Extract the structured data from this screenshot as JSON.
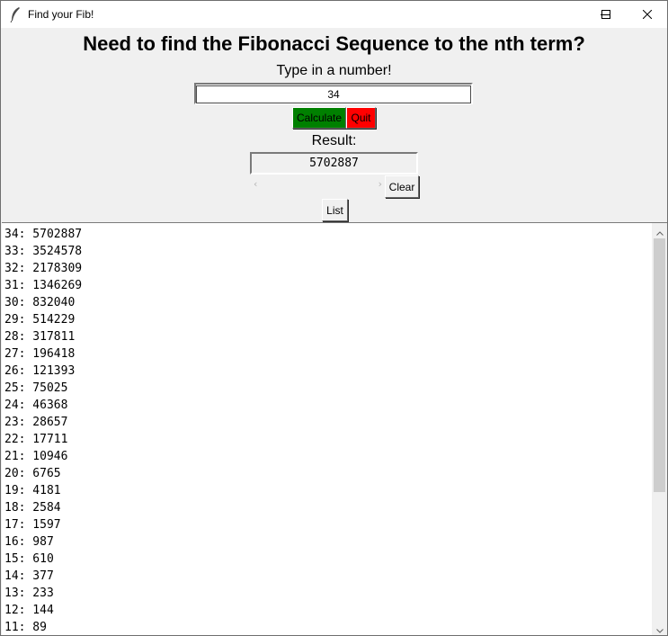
{
  "window": {
    "title": "Find your Fib!"
  },
  "heading": "Need to find the Fibonacci Sequence to the nth term?",
  "prompt": "Type in a number!",
  "input": {
    "value": "34"
  },
  "buttons": {
    "calculate": "Calculate",
    "quit": "Quit",
    "clear": "Clear",
    "list": "List"
  },
  "colors": {
    "calculate_bg": "#008000",
    "quit_bg": "#ff0000"
  },
  "result": {
    "label": "Result:",
    "value": "5702887"
  },
  "list_items": [
    "34: 5702887",
    "33: 3524578",
    "32: 2178309",
    "31: 1346269",
    "30: 832040",
    "29: 514229",
    "28: 317811",
    "27: 196418",
    "26: 121393",
    "25: 75025",
    "24: 46368",
    "23: 28657",
    "22: 17711",
    "21: 10946",
    "20: 6765",
    "19: 4181",
    "18: 2584",
    "17: 1597",
    "16: 987",
    "15: 610",
    "14: 377",
    "13: 233",
    "12: 144",
    "11: 89"
  ]
}
